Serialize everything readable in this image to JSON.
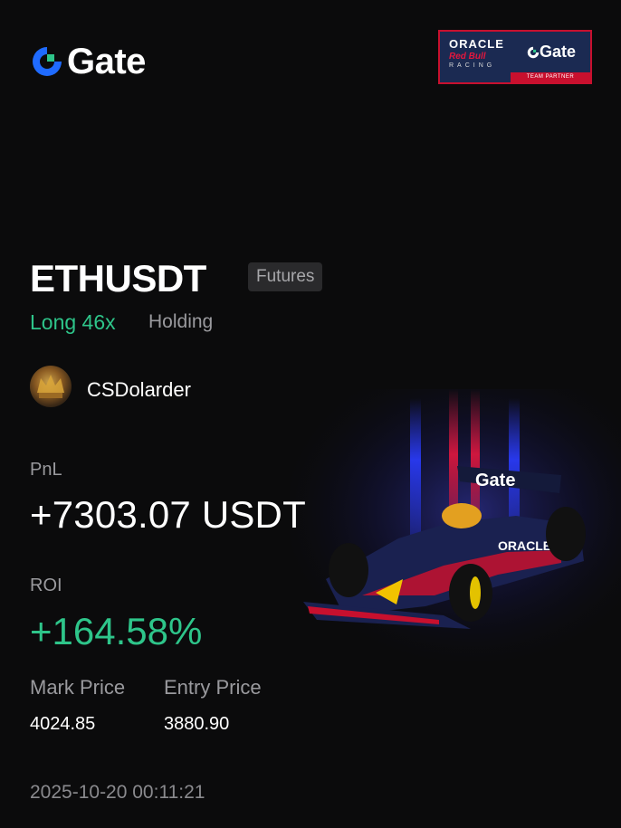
{
  "brand": {
    "name": "Gate",
    "accent": "#2ec58a",
    "logo_blue": "#1f6bff"
  },
  "partner": {
    "oracle": "ORACLE",
    "red_bull": "Red Bull",
    "racing": "RACING",
    "gate": "Gate",
    "team_partner": "TEAM PARTNER"
  },
  "position": {
    "symbol": "ETHUSDT",
    "type_chip": "Futures",
    "side": "Long 46x",
    "status": "Holding"
  },
  "user": {
    "name": "CSDolarder",
    "avatar_icon": "avatar-image"
  },
  "pnl": {
    "label": "PnL",
    "value": "+7303.07 USDT"
  },
  "roi": {
    "label": "ROI",
    "value": "+164.58%"
  },
  "prices": {
    "mark_label": "Mark Price",
    "mark_value": "4024.85",
    "entry_label": "Entry Price",
    "entry_value": "3880.90"
  },
  "timestamp": "2025-10-20 00:11:21",
  "colors": {
    "positive": "#2ec58a",
    "muted": "#9a9a9e",
    "background": "#0b0b0c"
  }
}
